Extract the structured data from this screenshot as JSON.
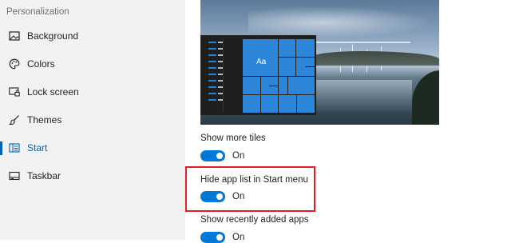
{
  "sidebar": {
    "section_title": "Personalization",
    "items": [
      {
        "label": "Background",
        "icon": "picture-icon"
      },
      {
        "label": "Colors",
        "icon": "palette-icon"
      },
      {
        "label": "Lock screen",
        "icon": "lock-screen-icon"
      },
      {
        "label": "Themes",
        "icon": "brush-icon"
      },
      {
        "label": "Start",
        "icon": "start-icon",
        "active": true
      },
      {
        "label": "Taskbar",
        "icon": "taskbar-icon"
      }
    ]
  },
  "preview": {
    "tile_text": "Aa"
  },
  "settings": [
    {
      "label": "Show more tiles",
      "state": "On",
      "on": true
    },
    {
      "label": "Hide app list in Start menu",
      "state": "On",
      "on": true,
      "highlighted": true
    },
    {
      "label": "Show recently added apps",
      "state": "On",
      "on": true
    }
  ],
  "colors": {
    "accent": "#0078d7",
    "active_nav": "#0063b1",
    "highlight": "#e61c24"
  }
}
